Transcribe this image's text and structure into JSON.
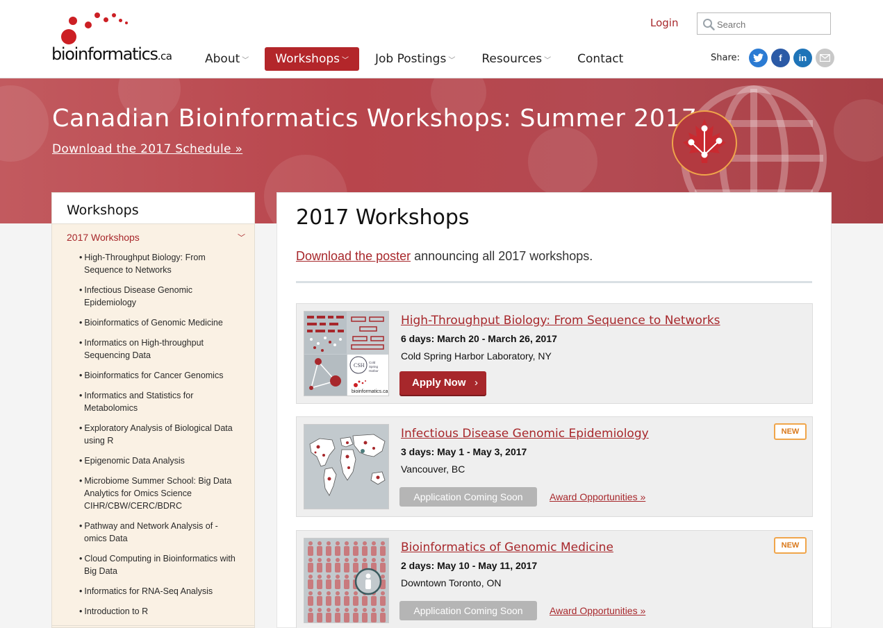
{
  "site": {
    "logo_main": "bioinformatics",
    "logo_suffix": ".ca"
  },
  "nav": {
    "items": [
      {
        "label": "About",
        "has_menu": true
      },
      {
        "label": "Workshops",
        "has_menu": true,
        "active": true
      },
      {
        "label": "Job Postings",
        "has_menu": true
      },
      {
        "label": "Resources",
        "has_menu": true
      },
      {
        "label": "Contact",
        "has_menu": false
      }
    ]
  },
  "header": {
    "login": "Login",
    "search_placeholder": "Search",
    "share_label": "Share:",
    "social_icons": [
      "twitter-icon",
      "facebook-icon",
      "linkedin-icon",
      "email-icon"
    ]
  },
  "hero": {
    "title": "Canadian Bioinformatics Workshops: Summer 2017",
    "schedule_link": "Download the 2017 Schedule »"
  },
  "sidebar": {
    "heading": "Workshops",
    "group": "2017 Workshops",
    "items": [
      "High-Throughput Biology: From Sequence to Networks",
      "Infectious Disease Genomic Epidemiology",
      "Bioinformatics of Genomic Medicine",
      "Informatics on High-throughput Sequencing Data",
      "Bioinformatics for Cancer Genomics",
      "Informatics and Statistics for Metabolomics",
      "Exploratory Analysis of Biological Data using R",
      "Epigenomic Data Analysis",
      "Microbiome Summer School: Big Data Analytics for Omics Science CIHR/CBW/CERC/BDRC",
      "Pathway and Network Analysis of -omics Data",
      "Cloud Computing in Bioinformatics with Big Data",
      "Informatics for RNA-Seq Analysis",
      "Introduction to R"
    ]
  },
  "main": {
    "title": "2017 Workshops",
    "intro_link": "Download the poster",
    "intro_rest": " announcing all 2017 workshops."
  },
  "cards": [
    {
      "title": "High-Throughput Biology: From Sequence to Networks",
      "dates": "6 days: March 20 - March 26, 2017",
      "location": "Cold Spring Harbor Laboratory, NY",
      "button": "Apply Now",
      "button_arrow": "›"
    },
    {
      "title": "Infectious Disease Genomic Epidemiology",
      "dates": "3 days: May 1 - May 3, 2017",
      "location": "Vancouver, BC",
      "button": "Application Coming Soon",
      "award": "Award Opportunities »",
      "badge": "NEW"
    },
    {
      "title": "Bioinformatics of Genomic Medicine",
      "dates": "2 days: May 10 - May 11, 2017",
      "location": "Downtown Toronto, ON",
      "button": "Application Coming Soon",
      "award": "Award Opportunities »",
      "badge": "NEW"
    }
  ],
  "colors": {
    "brand_red": "#a7272b",
    "hero_red": "#b8454c",
    "badge_orange": "#f0a54a",
    "sidebar_bg": "#faf1e4"
  }
}
